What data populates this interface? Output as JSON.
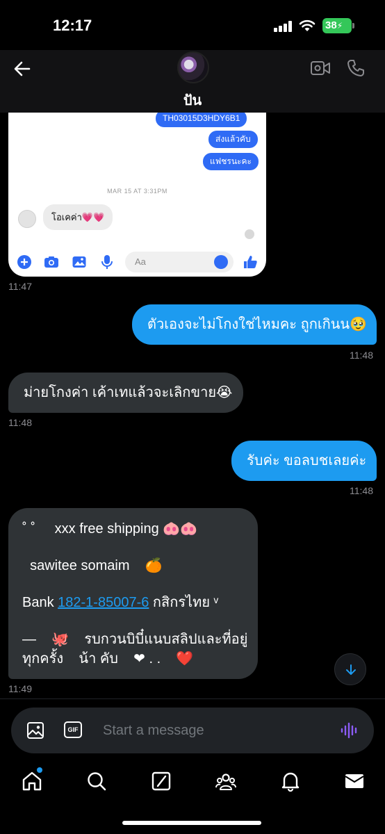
{
  "status_bar": {
    "time": "12:17",
    "battery": "38"
  },
  "header": {
    "contact_name": "ปัน"
  },
  "screenshot_card": {
    "sent_messages": [
      "TH03015D3HDY6B1",
      "ส่งแล้วคับ",
      "แฟชรนะคะ"
    ],
    "date_label": "MAR 15 AT 3:31PM",
    "received_message": "โอเคค่า💗💗",
    "input_placeholder": "Aa"
  },
  "messages": [
    {
      "time": "11:47"
    },
    {
      "text": "ตัวเองจะไม่โกงใช่ไหมคะ ถูกเกินน🥹",
      "time": "11:48"
    },
    {
      "text": "ม่ายโกงค่า เค้าเทแล้วจะเลิกขาย😭",
      "time": "11:48"
    },
    {
      "text": "รับค่ะ ขอลบชเลยค่ะ",
      "time": "11:48"
    }
  ],
  "multi_message": {
    "line1": "˚ ˚     xxx free shipping 🐽🐽",
    "line2": "  sawitee somaim    🍊",
    "bank_prefix": "Bank ",
    "bank_number": "182-1-85007-6",
    "bank_suffix": " กสิกรไทย ᵛ",
    "line4": "—    🐙    รบกวนบิบี๋แนบสลิปและที่อยู่",
    "line5": "ทุกครั้ง    น้า คับ    ❤ . .    ❤️",
    "time": "11:49"
  },
  "composer": {
    "placeholder": "Start a message"
  },
  "colors": {
    "accent": "#1d9bf0",
    "incoming_bubble": "#2f3336",
    "messenger_blue": "#2f6bf5",
    "battery_green": "#34c759"
  }
}
